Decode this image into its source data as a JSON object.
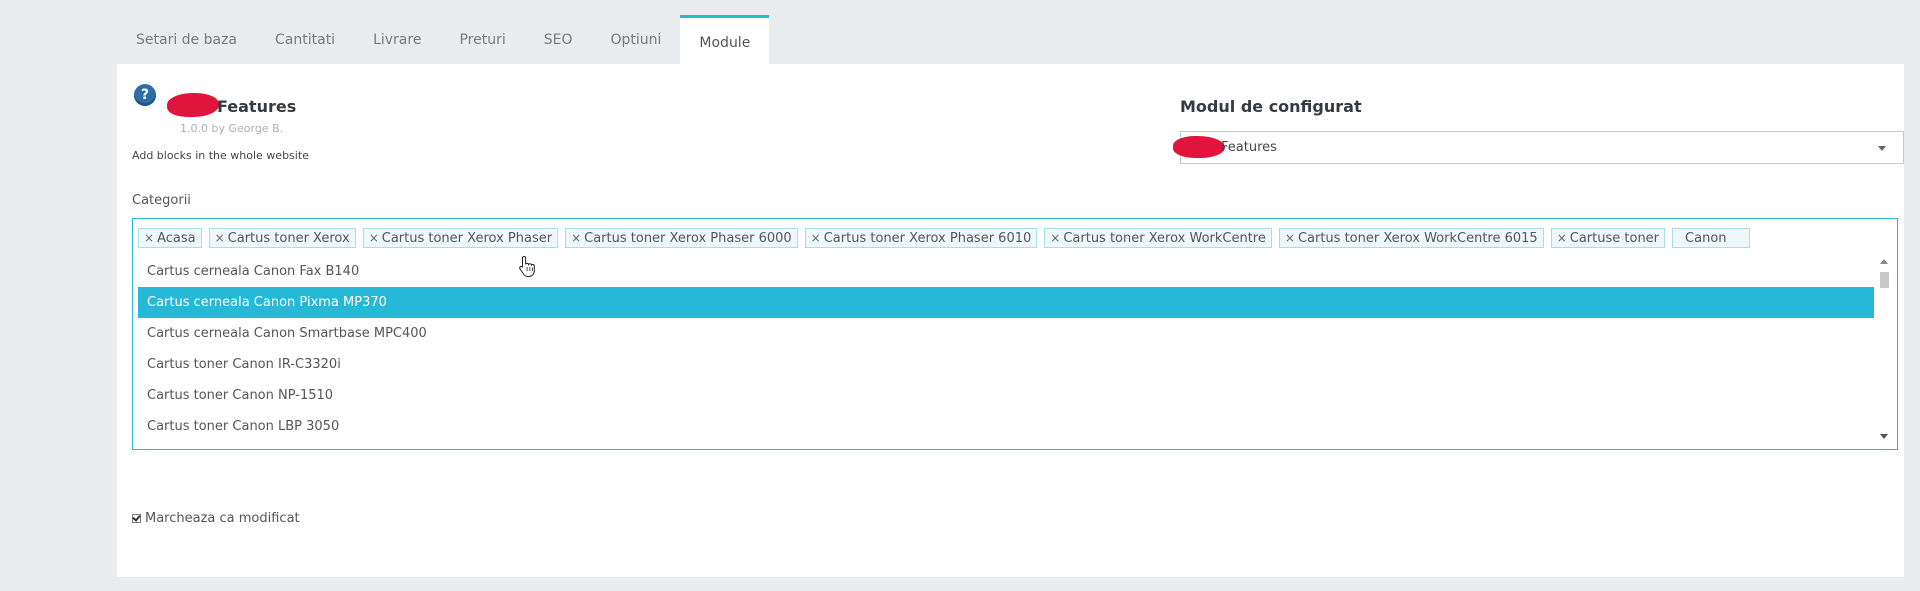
{
  "tabs": [
    {
      "label": "Setari de baza",
      "active": false
    },
    {
      "label": "Cantitati",
      "active": false
    },
    {
      "label": "Livrare",
      "active": false
    },
    {
      "label": "Preturi",
      "active": false
    },
    {
      "label": "SEO",
      "active": false
    },
    {
      "label": "Optiuni",
      "active": false
    },
    {
      "label": "Module",
      "active": true
    }
  ],
  "module": {
    "help_icon": "?",
    "title": "Features",
    "version": "1.0.0 by George B.",
    "description": "Add blocks in the whole website"
  },
  "config": {
    "label": "Modul de configurat",
    "selected": "Features"
  },
  "categories": {
    "label": "Categorii",
    "chips": [
      "Acasa",
      "Cartus toner Xerox",
      "Cartus toner Xerox Phaser",
      "Cartus toner Xerox Phaser 6000",
      "Cartus toner Xerox Phaser 6010",
      "Cartus toner Xerox WorkCentre",
      "Cartus toner Xerox WorkCentre 6015",
      "Cartuse toner"
    ],
    "remove_glyph": "×",
    "search_value": "Canon",
    "options": [
      {
        "label": "Cartus cerneala Canon Fax B140",
        "highlighted": false
      },
      {
        "label": "Cartus cerneala Canon Pixma MP370",
        "highlighted": true
      },
      {
        "label": "Cartus cerneala Canon Smartbase MPC400",
        "highlighted": false
      },
      {
        "label": "Cartus toner Canon IR-C3320i",
        "highlighted": false
      },
      {
        "label": "Cartus toner Canon NP-1510",
        "highlighted": false
      },
      {
        "label": "Cartus toner Canon LBP 3050",
        "highlighted": false
      }
    ]
  },
  "mark_modified": {
    "label": "Marcheaza ca modificat",
    "checked": true
  },
  "colors": {
    "accent": "#25b9d7",
    "redaction": "#e0143c",
    "help_icon": "#2d6ea8"
  }
}
